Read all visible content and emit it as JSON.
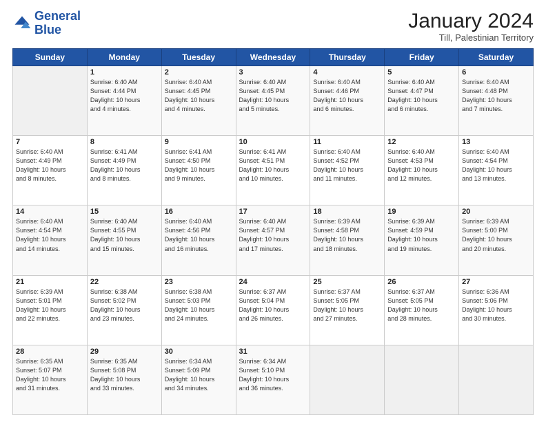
{
  "logo": {
    "line1": "General",
    "line2": "Blue"
  },
  "header": {
    "month_title": "January 2024",
    "subtitle": "Till, Palestinian Territory"
  },
  "days_of_week": [
    "Sunday",
    "Monday",
    "Tuesday",
    "Wednesday",
    "Thursday",
    "Friday",
    "Saturday"
  ],
  "weeks": [
    [
      {
        "day": "",
        "info": ""
      },
      {
        "day": "1",
        "info": "Sunrise: 6:40 AM\nSunset: 4:44 PM\nDaylight: 10 hours\nand 4 minutes."
      },
      {
        "day": "2",
        "info": "Sunrise: 6:40 AM\nSunset: 4:45 PM\nDaylight: 10 hours\nand 4 minutes."
      },
      {
        "day": "3",
        "info": "Sunrise: 6:40 AM\nSunset: 4:45 PM\nDaylight: 10 hours\nand 5 minutes."
      },
      {
        "day": "4",
        "info": "Sunrise: 6:40 AM\nSunset: 4:46 PM\nDaylight: 10 hours\nand 6 minutes."
      },
      {
        "day": "5",
        "info": "Sunrise: 6:40 AM\nSunset: 4:47 PM\nDaylight: 10 hours\nand 6 minutes."
      },
      {
        "day": "6",
        "info": "Sunrise: 6:40 AM\nSunset: 4:48 PM\nDaylight: 10 hours\nand 7 minutes."
      }
    ],
    [
      {
        "day": "7",
        "info": "Sunrise: 6:40 AM\nSunset: 4:49 PM\nDaylight: 10 hours\nand 8 minutes."
      },
      {
        "day": "8",
        "info": "Sunrise: 6:41 AM\nSunset: 4:49 PM\nDaylight: 10 hours\nand 8 minutes."
      },
      {
        "day": "9",
        "info": "Sunrise: 6:41 AM\nSunset: 4:50 PM\nDaylight: 10 hours\nand 9 minutes."
      },
      {
        "day": "10",
        "info": "Sunrise: 6:41 AM\nSunset: 4:51 PM\nDaylight: 10 hours\nand 10 minutes."
      },
      {
        "day": "11",
        "info": "Sunrise: 6:40 AM\nSunset: 4:52 PM\nDaylight: 10 hours\nand 11 minutes."
      },
      {
        "day": "12",
        "info": "Sunrise: 6:40 AM\nSunset: 4:53 PM\nDaylight: 10 hours\nand 12 minutes."
      },
      {
        "day": "13",
        "info": "Sunrise: 6:40 AM\nSunset: 4:54 PM\nDaylight: 10 hours\nand 13 minutes."
      }
    ],
    [
      {
        "day": "14",
        "info": "Sunrise: 6:40 AM\nSunset: 4:54 PM\nDaylight: 10 hours\nand 14 minutes."
      },
      {
        "day": "15",
        "info": "Sunrise: 6:40 AM\nSunset: 4:55 PM\nDaylight: 10 hours\nand 15 minutes."
      },
      {
        "day": "16",
        "info": "Sunrise: 6:40 AM\nSunset: 4:56 PM\nDaylight: 10 hours\nand 16 minutes."
      },
      {
        "day": "17",
        "info": "Sunrise: 6:40 AM\nSunset: 4:57 PM\nDaylight: 10 hours\nand 17 minutes."
      },
      {
        "day": "18",
        "info": "Sunrise: 6:39 AM\nSunset: 4:58 PM\nDaylight: 10 hours\nand 18 minutes."
      },
      {
        "day": "19",
        "info": "Sunrise: 6:39 AM\nSunset: 4:59 PM\nDaylight: 10 hours\nand 19 minutes."
      },
      {
        "day": "20",
        "info": "Sunrise: 6:39 AM\nSunset: 5:00 PM\nDaylight: 10 hours\nand 20 minutes."
      }
    ],
    [
      {
        "day": "21",
        "info": "Sunrise: 6:39 AM\nSunset: 5:01 PM\nDaylight: 10 hours\nand 22 minutes."
      },
      {
        "day": "22",
        "info": "Sunrise: 6:38 AM\nSunset: 5:02 PM\nDaylight: 10 hours\nand 23 minutes."
      },
      {
        "day": "23",
        "info": "Sunrise: 6:38 AM\nSunset: 5:03 PM\nDaylight: 10 hours\nand 24 minutes."
      },
      {
        "day": "24",
        "info": "Sunrise: 6:37 AM\nSunset: 5:04 PM\nDaylight: 10 hours\nand 26 minutes."
      },
      {
        "day": "25",
        "info": "Sunrise: 6:37 AM\nSunset: 5:05 PM\nDaylight: 10 hours\nand 27 minutes."
      },
      {
        "day": "26",
        "info": "Sunrise: 6:37 AM\nSunset: 5:05 PM\nDaylight: 10 hours\nand 28 minutes."
      },
      {
        "day": "27",
        "info": "Sunrise: 6:36 AM\nSunset: 5:06 PM\nDaylight: 10 hours\nand 30 minutes."
      }
    ],
    [
      {
        "day": "28",
        "info": "Sunrise: 6:35 AM\nSunset: 5:07 PM\nDaylight: 10 hours\nand 31 minutes."
      },
      {
        "day": "29",
        "info": "Sunrise: 6:35 AM\nSunset: 5:08 PM\nDaylight: 10 hours\nand 33 minutes."
      },
      {
        "day": "30",
        "info": "Sunrise: 6:34 AM\nSunset: 5:09 PM\nDaylight: 10 hours\nand 34 minutes."
      },
      {
        "day": "31",
        "info": "Sunrise: 6:34 AM\nSunset: 5:10 PM\nDaylight: 10 hours\nand 36 minutes."
      },
      {
        "day": "",
        "info": ""
      },
      {
        "day": "",
        "info": ""
      },
      {
        "day": "",
        "info": ""
      }
    ]
  ]
}
